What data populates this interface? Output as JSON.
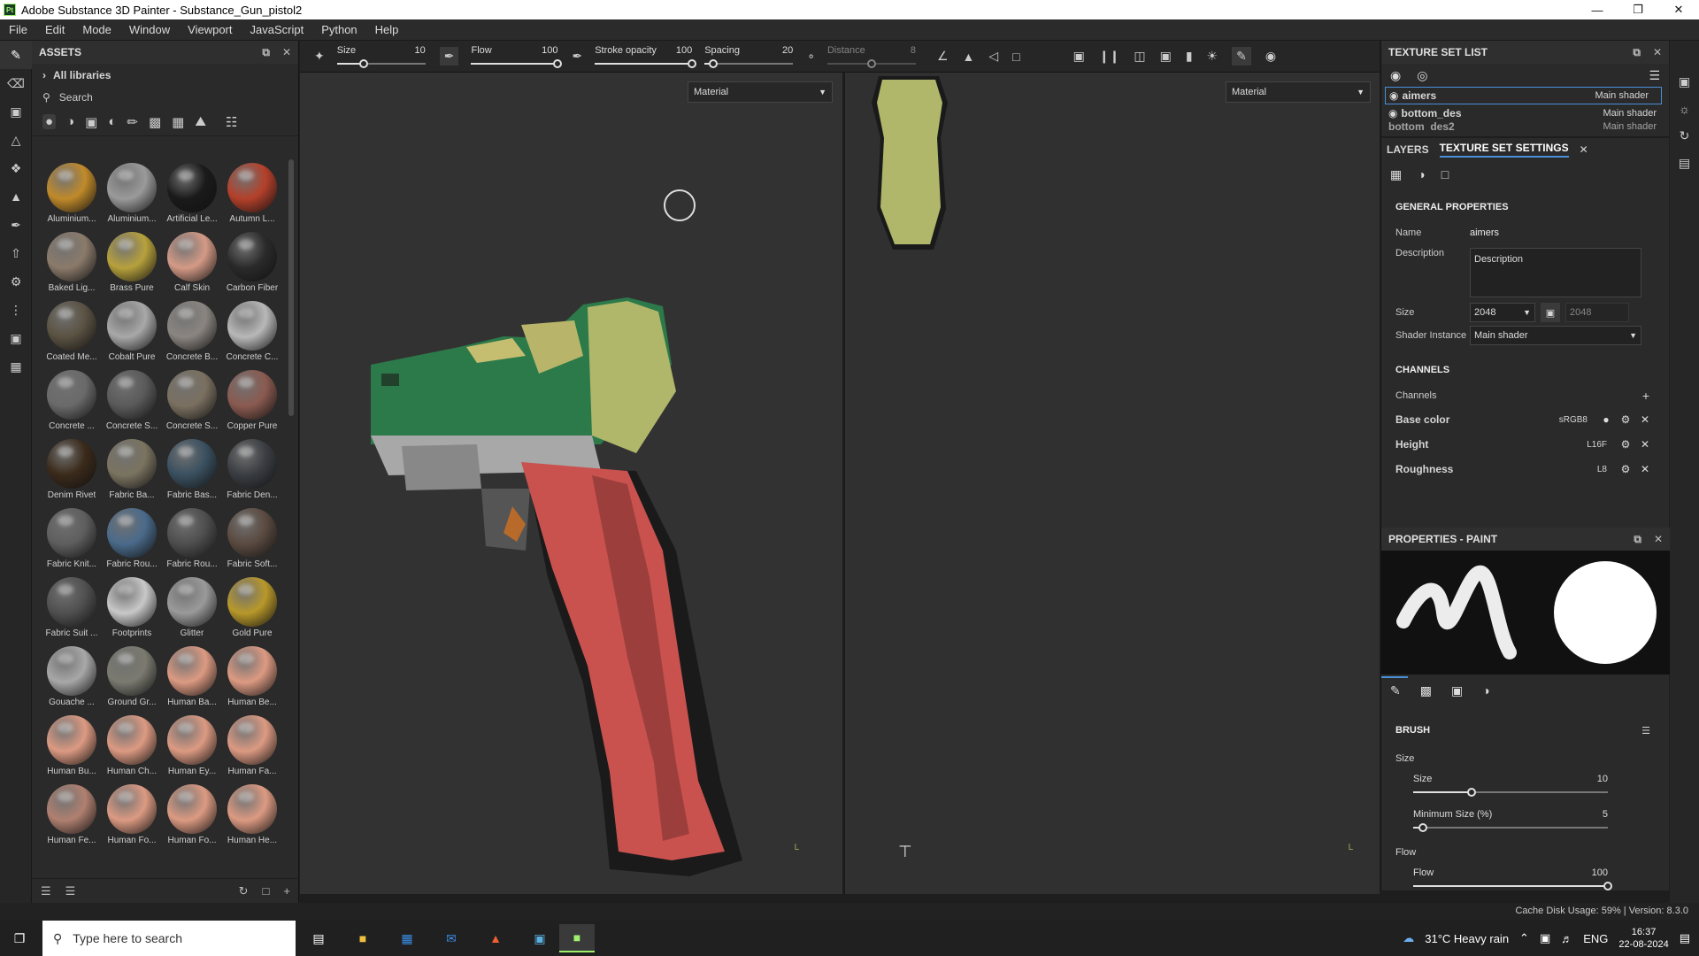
{
  "window": {
    "title": "Adobe Substance 3D Painter - Substance_Gun_pistol2",
    "logo": "Pt"
  },
  "menu": [
    "File",
    "Edit",
    "Mode",
    "Window",
    "Viewport",
    "JavaScript",
    "Python",
    "Help"
  ],
  "assets": {
    "title": "ASSETS",
    "libraries": "All libraries",
    "search_placeholder": "Search",
    "materials": [
      {
        "label": "Aluminium...",
        "color": "#c08a2a"
      },
      {
        "label": "Aluminium...",
        "color": "#9a9a9a"
      },
      {
        "label": "Artificial Le...",
        "color": "#1a1a1a"
      },
      {
        "label": "Autumn L...",
        "color": "#b4402a"
      },
      {
        "label": "Baked Lig...",
        "color": "#8a7a6a"
      },
      {
        "label": "Brass Pure",
        "color": "#b7a13c"
      },
      {
        "label": "Calf Skin",
        "color": "#d49a86"
      },
      {
        "label": "Carbon Fiber",
        "color": "#2a2a2a"
      },
      {
        "label": "Coated Me...",
        "color": "#5a5242"
      },
      {
        "label": "Cobalt Pure",
        "color": "#a8a8a8"
      },
      {
        "label": "Concrete B...",
        "color": "#8a8580"
      },
      {
        "label": "Concrete C...",
        "color": "#b8b8b8"
      },
      {
        "label": "Concrete ...",
        "color": "#6a6a6a"
      },
      {
        "label": "Concrete S...",
        "color": "#5a5a5a"
      },
      {
        "label": "Concrete S...",
        "color": "#7a7060"
      },
      {
        "label": "Copper Pure",
        "color": "#8a5a50"
      },
      {
        "label": "Denim Rivet",
        "color": "#3a2a1a"
      },
      {
        "label": "Fabric Ba...",
        "color": "#7a7360"
      },
      {
        "label": "Fabric Bas...",
        "color": "#3a5060"
      },
      {
        "label": "Fabric Den...",
        "color": "#3a3d42"
      },
      {
        "label": "Fabric Knit...",
        "color": "#5e5e5e"
      },
      {
        "label": "Fabric Rou...",
        "color": "#4a6a8a"
      },
      {
        "label": "Fabric Rou...",
        "color": "#4e4e4e"
      },
      {
        "label": "Fabric Soft...",
        "color": "#5a4a40"
      },
      {
        "label": "Fabric Suit ...",
        "color": "#505050"
      },
      {
        "label": "Footprints",
        "color": "#c8c8c8"
      },
      {
        "label": "Glitter",
        "color": "#9a9a9a"
      },
      {
        "label": "Gold Pure",
        "color": "#b8982a"
      },
      {
        "label": "Gouache ...",
        "color": "#a8a8a8"
      },
      {
        "label": "Ground Gr...",
        "color": "#7a7a70"
      },
      {
        "label": "Human Ba...",
        "color": "#dc9a82"
      },
      {
        "label": "Human Be...",
        "color": "#dc9a82"
      },
      {
        "label": "Human Bu...",
        "color": "#dc9a82"
      },
      {
        "label": "Human Ch...",
        "color": "#dc9a82"
      },
      {
        "label": "Human Ey...",
        "color": "#dc9a82"
      },
      {
        "label": "Human Fa...",
        "color": "#dc9a82"
      },
      {
        "label": "Human Fe...",
        "color": "#b08070"
      },
      {
        "label": "Human Fo...",
        "color": "#dc9a82"
      },
      {
        "label": "Human Fo...",
        "color": "#dc9a82"
      },
      {
        "label": "Human He...",
        "color": "#dc9a82"
      }
    ]
  },
  "toolbar": {
    "size_label": "Size",
    "size_value": "10",
    "size_fraction": 0.3,
    "flow_label": "Flow",
    "flow_value": "100",
    "flow_fraction": 1.0,
    "stroke_label": "Stroke opacity",
    "stroke_value": "100",
    "stroke_fraction": 1.0,
    "spacing_label": "Spacing",
    "spacing_value": "20",
    "spacing_fraction": 0.1,
    "distance_label": "Distance",
    "distance_value": "8",
    "distance_fraction": 0.5
  },
  "viewport": {
    "left_mode": "Material",
    "right_mode": "Material"
  },
  "texture_set_list": {
    "title": "TEXTURE SET LIST",
    "rows": [
      {
        "name": "aimers",
        "shader": "Main shader"
      },
      {
        "name": "bottom_des",
        "shader": "Main shader"
      },
      {
        "name": "bottom_des2",
        "shader": "Main shader"
      }
    ]
  },
  "tabs": {
    "layers": "LAYERS",
    "settings": "TEXTURE SET SETTINGS"
  },
  "general": {
    "title": "GENERAL PROPERTIES",
    "name_label": "Name",
    "name_value": "aimers",
    "desc_label": "Description",
    "desc_value": "Description",
    "size_label": "Size",
    "size_value": "2048",
    "size_value2": "2048",
    "shader_label": "Shader Instance",
    "shader_value": "Main shader"
  },
  "channels": {
    "title": "CHANNELS",
    "label": "Channels",
    "items": [
      {
        "name": "Base color",
        "fmt": "sRGB8"
      },
      {
        "name": "Height",
        "fmt": "L16F"
      },
      {
        "name": "Roughness",
        "fmt": "L8"
      }
    ]
  },
  "paint": {
    "title": "PROPERTIES - PAINT",
    "brush_title": "BRUSH",
    "size_group": "Size",
    "size_label": "Size",
    "size_value": "10",
    "size_fraction": 0.3,
    "minsize_label": "Minimum Size (%)",
    "minsize_value": "5",
    "minsize_fraction": 0.05,
    "flow_group": "Flow",
    "flow_label": "Flow",
    "flow_value": "100",
    "flow_fraction": 1.0
  },
  "status": {
    "cache": "Cache Disk Usage:",
    "cache_value": "59%",
    "version": "Version: 8.3.0"
  },
  "taskbar": {
    "search": "Type here to search",
    "weather": "31°C  Heavy rain",
    "lang": "ENG",
    "time": "16:37",
    "date": "22-08-2024"
  }
}
